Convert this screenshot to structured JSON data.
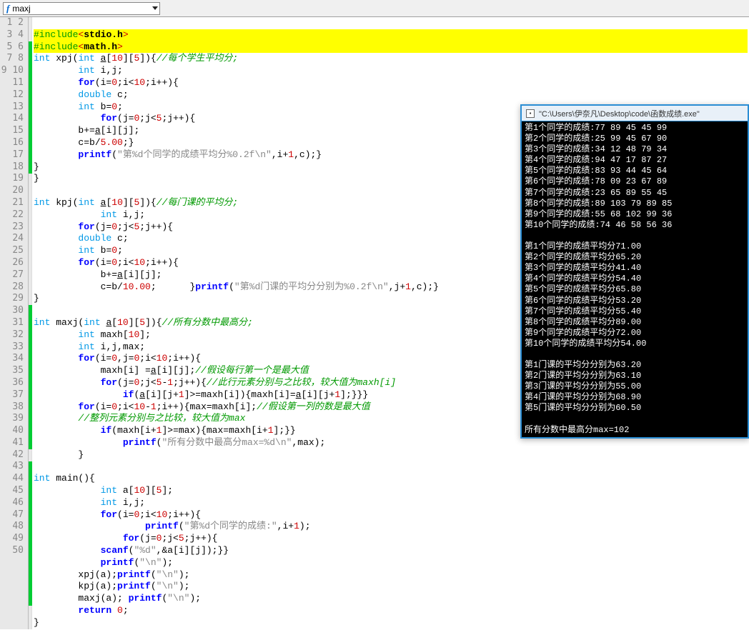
{
  "toolbar": {
    "dropdown_label": "maxj"
  },
  "gutter": {
    "lines": [
      "1",
      "2",
      "3",
      "4",
      "5",
      "6",
      "7",
      "8",
      "9",
      "10",
      "11",
      "12",
      "13",
      "14",
      "15",
      "16",
      "17",
      "18",
      "19",
      "20",
      "21",
      "22",
      "23",
      "24",
      "25",
      "26",
      "27",
      "28",
      "29",
      "30",
      "31",
      "32",
      "33",
      "34",
      "35",
      "36",
      "37",
      "38",
      "39",
      "40",
      "41",
      "42",
      "43",
      "44",
      "45",
      "46",
      "47",
      "48",
      "49",
      "50"
    ]
  },
  "code": {
    "l1_include": "#include",
    "l1_langle": "<",
    "l1_lib": "stdio.h",
    "l1_rangle": ">",
    "l2_include": "#include",
    "l2_langle": "<",
    "l2_lib": "math.h",
    "l2_rangle": ">",
    "l3_int": "int ",
    "l3_fn": "xpj(",
    "l3_int2": "int ",
    "l3_a": "a",
    "l3_br": "[",
    "l3_n10": "10",
    "l3_br2": "][",
    "l3_n5": "5",
    "l3_rest": "]){",
    "l3_cmt": "//每个学生平均分;",
    "l4": "        int i,j;",
    "l4_int": "int ",
    "l4_rest": "i,j;",
    "l5_for": "for",
    "l5_a": "(i=",
    "l5_n0": "0",
    "l5_b": ";i<",
    "l5_n10": "10",
    "l5_rest": ";i++){",
    "l6_dbl": "double ",
    "l6_rest": "c;",
    "l7_int": "int ",
    "l7_rest": "b=",
    "l7_n0": "0",
    "l7_semi": ";",
    "l8_for": "for",
    "l8_a": "(j=",
    "l8_n0": "0",
    "l8_b": ";j<",
    "l8_n5": "5",
    "l8_rest": ";j++){",
    "l9_a": "        b+=",
    "l9_au": "a",
    "l9_rest": "[i][j];",
    "l10_a": "        c=b/",
    "l10_n": "5.00",
    "l10_rest": ";}",
    "l11_pf": "printf",
    "l11_lp": "(",
    "l11_str": "\"第%d个同学的成绩平均分%0.2f\\n\"",
    "l11_rest": ",i+",
    "l11_n1": "1",
    "l11_rest2": ",c);}",
    "l12": "}",
    "l13": "}",
    "l15_int": "int ",
    "l15_fn": "kpj(",
    "l15_int2": "int ",
    "l15_a": "a",
    "l15_br": "[",
    "l15_n10": "10",
    "l15_br2": "][",
    "l15_n5": "5",
    "l15_rest": "]){",
    "l15_cmt": "//每门课的平均分;",
    "l16_int": "int ",
    "l16_rest": "i,j;",
    "l17_for": "for",
    "l17_a": "(j=",
    "l17_n0": "0",
    "l17_b": ";j<",
    "l17_n5": "5",
    "l17_rest": ";j++){",
    "l18_dbl": "double ",
    "l18_rest": "c;",
    "l19_int": "int ",
    "l19_rest": "b=",
    "l19_n0": "0",
    "l19_semi": ";",
    "l20_for": "for",
    "l20_a": "(i=",
    "l20_n0": "0",
    "l20_b": ";i<",
    "l20_n10": "10",
    "l20_rest": ";i++){",
    "l21_a": "            b+=",
    "l21_au": "a",
    "l21_rest": "[i][j];",
    "l22_a": "            c=b/",
    "l22_n": "10.00",
    "l22_b": ";      }",
    "l22_pf": "printf",
    "l22_lp": "(",
    "l22_str": "\"第%d门课的平均分分别为%0.2f\\n\"",
    "l22_rest": ",j+",
    "l22_n1": "1",
    "l22_rest2": ",c);}",
    "l23": "}",
    "l25_int": "int ",
    "l25_fn": "maxj(",
    "l25_int2": "int ",
    "l25_a": "a",
    "l25_br": "[",
    "l25_n10": "10",
    "l25_br2": "][",
    "l25_n5": "5",
    "l25_rest": "]){",
    "l25_cmt": "//所有分数中最高分;",
    "l26_int": "int ",
    "l26_rest": "maxh[",
    "l26_n10": "10",
    "l26_rest2": "];",
    "l27_int": "int ",
    "l27_rest": "i,j,max;",
    "l28_for": "for",
    "l28_a": "(i=",
    "l28_n0": "0",
    "l28_b": ",j=",
    "l28_n0b": "0",
    "l28_c": ";i<",
    "l28_n10": "10",
    "l28_rest": ";i++){",
    "l29_a": "            maxh[i] =",
    "l29_au": "a",
    "l29_rest": "[i][j];",
    "l29_cmt": "//假设每行第一个是最大值",
    "l30_for": "for",
    "l30_a": "(j=",
    "l30_n0": "0",
    "l30_b": ";j<",
    "l30_n5": "5",
    "l30_c": "-",
    "l30_n1": "1",
    "l30_rest": ";j++){",
    "l30_cmt": "//此行元素分别与之比较，较大值为maxh[i]",
    "l31_if": "if",
    "l31_a": "(",
    "l31_au": "a",
    "l31_b": "[i][j+",
    "l31_n1": "1",
    "l31_c": "]>=maxh[i]){maxh[i]=",
    "l31_au2": "a",
    "l31_d": "[i][j+",
    "l31_n1b": "1",
    "l31_rest": "];}}}",
    "l32_for": "for",
    "l32_a": "(i=",
    "l32_n0": "0",
    "l32_b": ";i<",
    "l32_n10": "10",
    "l32_c": "-",
    "l32_n1": "1",
    "l32_d": ";i++){max=maxh[i];",
    "l32_cmt": "//假设第一列的数是最大值",
    "l33_cmt": "//整列元素分别与之比较，较大值为max",
    "l34_if": "if",
    "l34_a": "(maxh[i+",
    "l34_n1": "1",
    "l34_b": "]>=max){max=maxh[i+",
    "l34_n1b": "1",
    "l34_rest": "];}}",
    "l35_pf": "printf",
    "l35_lp": "(",
    "l35_str": "\"所有分数中最高分max=%d\\n\"",
    "l35_rest": ",max);",
    "l36": "        }",
    "l38_int": "int ",
    "l38_rest": "main(){",
    "l39_int": "int ",
    "l39_rest": "a[",
    "l39_n10": "10",
    "l39_b": "][",
    "l39_n5": "5",
    "l39_rest2": "];",
    "l40_int": "int ",
    "l40_rest": "i,j;",
    "l41_for": "for",
    "l41_a": "(i=",
    "l41_n0": "0",
    "l41_b": ";i<",
    "l41_n10": "10",
    "l41_rest": ";i++){",
    "l42_pf": "printf",
    "l42_lp": "(",
    "l42_str": "\"第%d个同学的成绩:\"",
    "l42_rest": ",i+",
    "l42_n1": "1",
    "l42_rest2": ");",
    "l43_for": "for",
    "l43_a": "(j=",
    "l43_n0": "0",
    "l43_b": ";j<",
    "l43_n5": "5",
    "l43_rest": ";j++){",
    "l44_sc": "scanf",
    "l44_lp": "(",
    "l44_str": "\"%d\"",
    "l44_rest": ",&a[i][j]);}}",
    "l45_pf": "printf",
    "l45_lp": "(",
    "l45_str": "\"\\n\"",
    "l45_rest": ");",
    "l46_a": "        xpj(a);",
    "l46_pf": "printf",
    "l46_lp": "(",
    "l46_str": "\"\\n\"",
    "l46_rest": ");",
    "l47_a": "        kpj(a);",
    "l47_pf": "printf",
    "l47_lp": "(",
    "l47_str": "\"\\n\"",
    "l47_rest": ");",
    "l48_a": "        maxj(a); ",
    "l48_pf": "printf",
    "l48_lp": "(",
    "l48_str": "\"\\n\"",
    "l48_rest": ");",
    "l49_ret": "return ",
    "l49_n0": "0",
    "l49_rest": ";",
    "l50": "}"
  },
  "console": {
    "title": "\"C:\\Users\\伊奈凡\\Desktop\\code\\函数成绩.exe\"",
    "lines": [
      "第1个同学的成绩:77 89 45 45 99",
      "第2个同学的成绩:25 99 45 67 90",
      "第3个同学的成绩:34 12 48 79 34",
      "第4个同学的成绩:94 47 17 87 27",
      "第5个同学的成绩:83 93 44 45 64",
      "第6个同学的成绩:78 09 23 67 89",
      "第7个同学的成绩:23 65 89 55 45",
      "第8个同学的成绩:89 103 79 89 85",
      "第9个同学的成绩:55 68 102 99 36",
      "第10个同学的成绩:74 46 58 56 36",
      "",
      "第1个同学的成绩平均分71.00",
      "第2个同学的成绩平均分65.20",
      "第3个同学的成绩平均分41.40",
      "第4个同学的成绩平均分54.40",
      "第5个同学的成绩平均分65.80",
      "第6个同学的成绩平均分53.20",
      "第7个同学的成绩平均分55.40",
      "第8个同学的成绩平均分89.00",
      "第9个同学的成绩平均分72.00",
      "第10个同学的成绩平均分54.00",
      "",
      "第1门课的平均分分别为63.20",
      "第2门课的平均分分别为63.10",
      "第3门课的平均分分别为55.00",
      "第4门课的平均分分别为68.90",
      "第5门课的平均分分别为60.50",
      "",
      "所有分数中最高分max=102"
    ]
  }
}
